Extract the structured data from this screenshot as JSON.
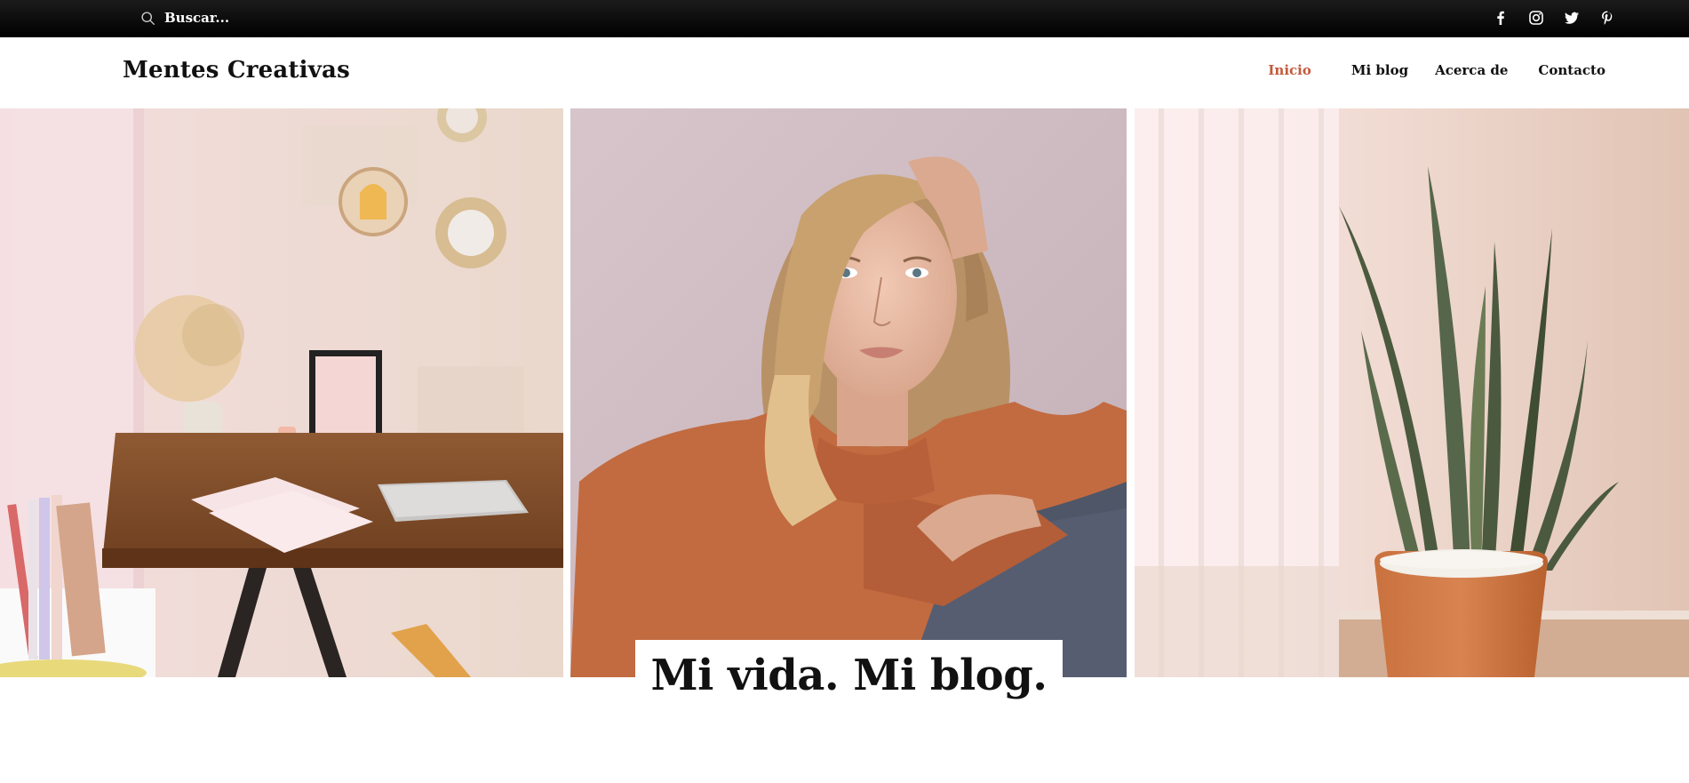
{
  "search": {
    "placeholder": "Buscar...",
    "icon": "search-icon"
  },
  "social": [
    {
      "name": "Facebook",
      "icon": "facebook-icon"
    },
    {
      "name": "Instagram",
      "icon": "instagram-icon"
    },
    {
      "name": "Twitter",
      "icon": "twitter-icon"
    },
    {
      "name": "Pinterest",
      "icon": "pinterest-icon"
    }
  ],
  "header": {
    "site_title": "Mentes Creativas",
    "nav": [
      {
        "label": "Inicio",
        "active": true
      },
      {
        "label": "Mi blog",
        "active": false
      },
      {
        "label": "Acerca de",
        "active": false
      },
      {
        "label": "Contacto",
        "active": false
      }
    ]
  },
  "hero": {
    "images": [
      "desk-workspace-photo",
      "woman-portrait-photo",
      "potted-snake-plant-photo"
    ],
    "headline": "Mi vida. Mi blog."
  },
  "colors": {
    "topbar": "#000000",
    "accent": "#c4593b",
    "text": "#111111",
    "background": "#ffffff"
  }
}
